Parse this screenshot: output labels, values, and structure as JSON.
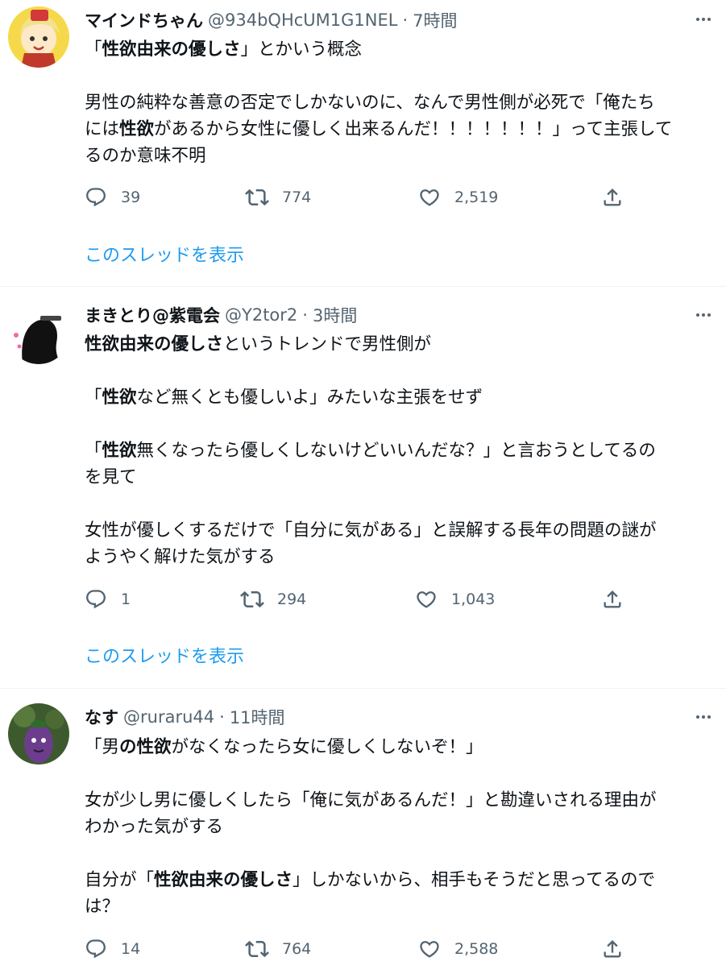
{
  "tweets": [
    {
      "name": "マインドちゃん",
      "handle": "@934bQHcUM1G1NEL",
      "separator": "·",
      "time": "7時間",
      "lines": [
        [
          {
            "t": "「",
            "b": false
          },
          {
            "t": "性欲由来の優しさ",
            "b": true
          },
          {
            "t": "」とかいう概念",
            "b": false
          }
        ],
        [],
        [
          {
            "t": "男性の純粋な善意の否定でしかないのに、なんで男性側が必死で「俺たち",
            "b": false
          }
        ],
        [
          {
            "t": "には",
            "b": false
          },
          {
            "t": "性欲",
            "b": true
          },
          {
            "t": "があるから女性に優しく出来るんだ！！！！！！！」って主張して",
            "b": false
          }
        ],
        [
          {
            "t": "るのか意味不明",
            "b": false
          }
        ]
      ],
      "replies": "39",
      "retweets": "774",
      "likes": "2,519",
      "thread_link": "このスレッドを表示"
    },
    {
      "name": "まきとり@紫電会",
      "handle": "@Y2tor2",
      "separator": "·",
      "time": "3時間",
      "lines": [
        [
          {
            "t": "性欲由来の優しさ",
            "b": true
          },
          {
            "t": "というトレンドで男性側が",
            "b": false
          }
        ],
        [],
        [
          {
            "t": "「",
            "b": false
          },
          {
            "t": "性欲",
            "b": true
          },
          {
            "t": "など無くとも優しいよ」みたいな主張をせず",
            "b": false
          }
        ],
        [],
        [
          {
            "t": "「",
            "b": false
          },
          {
            "t": "性欲",
            "b": true
          },
          {
            "t": "無くなったら優しくしないけどいいんだな？」と言おうとしてるの",
            "b": false
          }
        ],
        [
          {
            "t": "を見て",
            "b": false
          }
        ],
        [],
        [
          {
            "t": "女性が優しくするだけで「自分に気がある」と誤解する長年の問題の謎が",
            "b": false
          }
        ],
        [
          {
            "t": "ようやく解けた気がする",
            "b": false
          }
        ]
      ],
      "replies": "1",
      "retweets": "294",
      "likes": "1,043",
      "thread_link": "このスレッドを表示"
    },
    {
      "name": "なす",
      "handle": "@ruraru44",
      "separator": "·",
      "time": "11時間",
      "lines": [
        [
          {
            "t": "「男",
            "b": false
          },
          {
            "t": "の性欲",
            "b": true
          },
          {
            "t": "がなくなったら女に優しくしないぞ！」",
            "b": false
          }
        ],
        [],
        [
          {
            "t": "女が少し男に優しくしたら「俺に気があるんだ！」と勘違いされる理由が",
            "b": false
          }
        ],
        [
          {
            "t": "わかった気がする",
            "b": false
          }
        ],
        [],
        [
          {
            "t": "自分が「",
            "b": false
          },
          {
            "t": "性欲由来の優しさ",
            "b": true
          },
          {
            "t": "」しかないから、相手もそうだと思ってるので",
            "b": false
          }
        ],
        [
          {
            "t": "は？",
            "b": false
          }
        ]
      ],
      "replies": "14",
      "retweets": "764",
      "likes": "2,588"
    }
  ],
  "icons": {
    "more": "more-horizontal-icon",
    "reply": "reply-icon",
    "retweet": "retweet-icon",
    "like": "like-icon",
    "share": "share-icon"
  },
  "colors": {
    "text": "#0f1419",
    "secondary": "#536471",
    "link": "#1d9bf0",
    "divider": "#eff3f4"
  }
}
